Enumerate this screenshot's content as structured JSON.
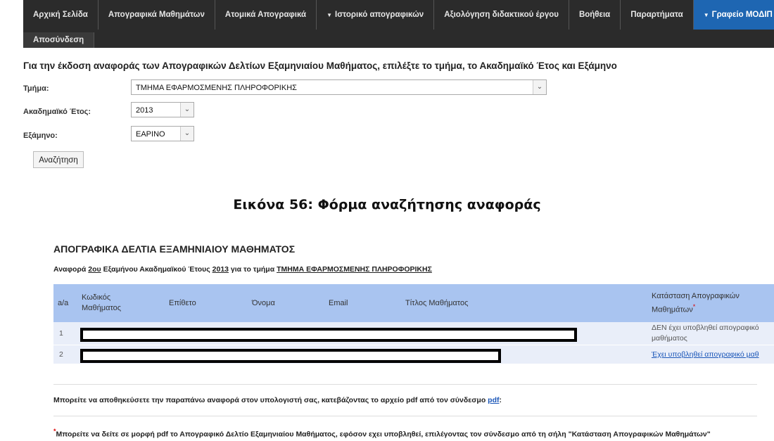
{
  "nav": {
    "row1": [
      {
        "label": "Αρχική Σελίδα",
        "caret": false
      },
      {
        "label": "Απογραφικά Μαθημάτων",
        "caret": false
      },
      {
        "label": "Ατομικά Απογραφικά",
        "caret": false
      },
      {
        "label": "Ιστορικό απογραφικών",
        "caret": true
      },
      {
        "label": "Αξιολόγηση διδακτικού έργου",
        "caret": false
      },
      {
        "label": "Βοήθεια",
        "caret": false
      },
      {
        "label": "Παραρτήματα",
        "caret": false
      },
      {
        "label": "Γραφείο ΜΟΔΙΠ",
        "caret": true
      }
    ],
    "row2": [
      {
        "label": "Αποσύνδεση"
      }
    ]
  },
  "form": {
    "title": "Για την έκδοση αναφοράς των Απογραφικών Δελτίων Εξαμηνιαίου Μαθήματος, επιλέξτε το τμήμα, το Ακαδημαϊκό Έτος και Εξάμηνο",
    "department_label": "Τμήμα:",
    "department_value": "ΤΜΗΜΑ ΕΦΑΡΜΟΣΜΕΝΗΣ ΠΛΗΡΟΦΟΡΙΚΗΣ",
    "year_label": "Ακαδημαϊκό Έτος:",
    "year_value": "2013",
    "semester_label": "Εξάμηνο:",
    "semester_value": "ΕΑΡΙΝΟ",
    "search_label": "Αναζήτηση"
  },
  "caption": "Εικόνα 56: Φόρμα αναζήτησης αναφοράς",
  "report": {
    "title": "ΑΠΟΓΡΑΦΙΚΑ ΔΕΛΤΙΑ ΕΞΑΜΗΝΙΑΙΟΥ ΜΑΘΗΜΑΤΟΣ",
    "sub_prefix": "Αναφορά ",
    "sub_semester": "2ου",
    "sub_mid": " Εξαμήνου Ακαδημαϊκού Έτους ",
    "sub_year": "2013",
    "sub_mid2": " για το τμήμα ",
    "sub_dept": "ΤΜΗΜΑ ΕΦΑΡΜΟΣΜΕΝΗΣ ΠΛΗΡΟΦΟΡΙΚΗΣ",
    "columns": [
      "a/a",
      "Κωδικός Μαθήματος",
      "Επίθετο",
      "Όνομα",
      "Email",
      "Τίτλος Μαθήματος",
      "Κατάσταση Απογραφικών Μαθημάτων"
    ],
    "rows": [
      {
        "num": "1",
        "status": "ΔΕΝ έχει υποβληθεί απογραφικό μαθήματος"
      },
      {
        "num": "2",
        "status": "Έχει υποβληθεί απογραφικό μαθ"
      }
    ],
    "note1_text": "Μπορείτε να αποθηκεύσετε την παραπάνω αναφορά στον υπολογιστή σας, κατεβάζοντας το αρχείο pdf από τον σύνδεσμο ",
    "note1_link": "pdf",
    "note1_end": ":",
    "note2_star": "*",
    "note2_text": "Μπορείτε να δείτε σε μορφή pdf το Απογραφικό Δελτίο Εξαμηνιαίου Μαθήματος, εφόσον εχει υποβληθεί, επιλέγοντας τον σύνδεσμο από τη σήλη \"Κατάσταση Απογραφικών Μαθημάτων\""
  },
  "colors": {
    "nav_bg": "#2b2b2b",
    "nav_active": "#1e66b2",
    "table_header": "#a9c4f0",
    "table_row": "#e9eef9",
    "link": "#1a56b8"
  }
}
